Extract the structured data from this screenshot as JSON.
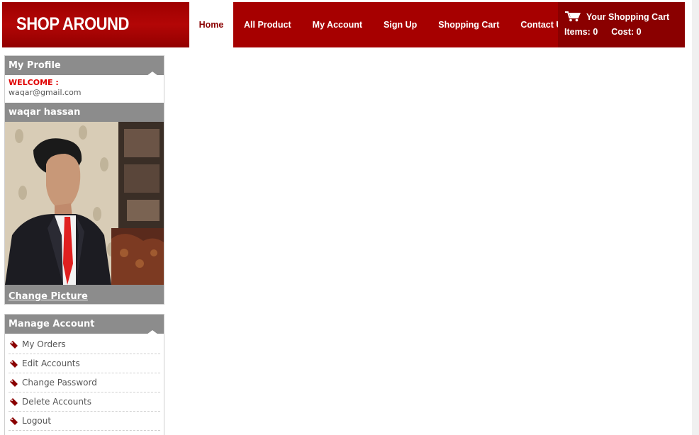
{
  "header": {
    "logo_text": "SHOP AROUND",
    "nav": {
      "home": "Home",
      "items": [
        "All Product",
        "My Account",
        "Sign Up",
        "Shopping Cart",
        "Contact Us"
      ]
    },
    "cart": {
      "title": "Your Shopping Cart",
      "items_label": "Items:",
      "items_value": "0",
      "cost_label": "Cost:",
      "cost_value": "0"
    }
  },
  "profile_panel": {
    "title": "My Profile",
    "welcome_label": "WELCOME :",
    "email": "waqar@gmail.com",
    "name": "waqar hassan",
    "change_picture": "Change Picture"
  },
  "manage_panel": {
    "title": "Manage Account",
    "items": [
      "My Orders",
      "Edit Accounts",
      "Change Password",
      "Delete Accounts",
      "Logout"
    ]
  },
  "colors": {
    "brand_red": "#a60000",
    "dark_red": "#8a0000",
    "panel_gray": "#8c8c8c",
    "welcome_red": "#e00000"
  },
  "icons": [
    "cart-icon",
    "tag-icon"
  ]
}
